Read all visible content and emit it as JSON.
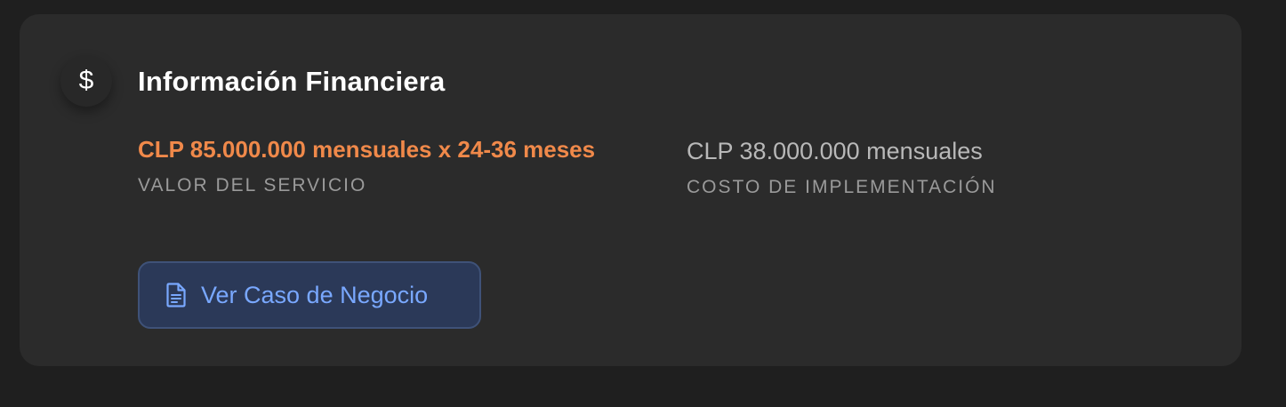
{
  "section": {
    "title": "Información Financiera",
    "icon": "dollar-icon",
    "icon_glyph": "$"
  },
  "financials": {
    "service_value": "CLP 85.000.000 mensuales x 24-36 meses",
    "service_label": "VALOR DEL SERVICIO",
    "implementation_value": "CLP 38.000.000 mensuales",
    "implementation_label": "COSTO DE IMPLEMENTACIÓN"
  },
  "actions": {
    "view_case_label": "Ver Caso de Negocio",
    "view_case_icon": "document-icon"
  },
  "colors": {
    "background": "#1f1f1f",
    "card": "#2b2b2b",
    "accent_orange": "#f0894a",
    "accent_blue": "#79a8ff",
    "button_bg": "#2b3958"
  }
}
